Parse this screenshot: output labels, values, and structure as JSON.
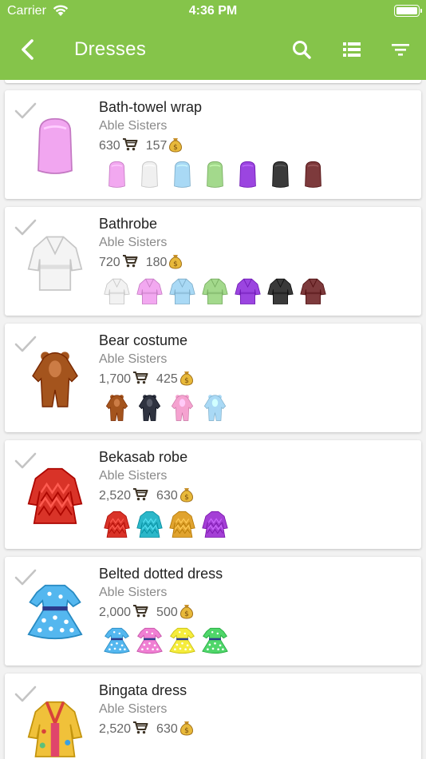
{
  "status_bar": {
    "carrier": "Carrier",
    "time": "4:36 PM"
  },
  "app_bar": {
    "title": "Dresses",
    "icons": [
      "back-arrow-icon",
      "search-icon",
      "list-view-icon",
      "filter-icon"
    ]
  },
  "colors": {
    "app_bar": "#85c44a",
    "background": "#f2f2f2",
    "card": "#ffffff"
  },
  "items": [
    {
      "name": "Bath-towel wrap",
      "maker": "Able Sisters",
      "buy_price": "630",
      "sell_price": "157",
      "shape": "towel",
      "main_color": "#f1a6f0",
      "variant_colors": [
        "#f2a8f0",
        "#f0f0f0",
        "#a9d9f5",
        "#a3d98c",
        "#9b45e0",
        "#3a3a3a",
        "#7d3a3c"
      ]
    },
    {
      "name": "Bathrobe",
      "maker": "Able Sisters",
      "buy_price": "720",
      "sell_price": "180",
      "shape": "robe",
      "main_color": "#f4f4f4",
      "variant_colors": [
        "#f2f2f2",
        "#f2a8f0",
        "#a9d9f5",
        "#a3d98c",
        "#9b45e0",
        "#3a3a3a",
        "#7d3a3c"
      ]
    },
    {
      "name": "Bear costume",
      "maker": "Able Sisters",
      "buy_price": "1,700",
      "sell_price": "425",
      "shape": "bear",
      "main_color": "#a4541d",
      "variant_colors": [
        "#a4541d",
        "#2f3340",
        "#f5a2d0",
        "#a9d9f5"
      ]
    },
    {
      "name": "Bekasab robe",
      "maker": "Able Sisters",
      "buy_price": "2,520",
      "sell_price": "630",
      "shape": "gown",
      "main_color": "#d93328",
      "variant_colors": [
        "#d93328",
        "#2bb7c9",
        "#e0a32e",
        "#a43fd6"
      ]
    },
    {
      "name": "Belted dotted dress",
      "maker": "Able Sisters",
      "buy_price": "2,000",
      "sell_price": "500",
      "shape": "dotted",
      "main_color": "#54b7ef",
      "variant_colors": [
        "#54b7ef",
        "#f07fd3",
        "#f5ec3c",
        "#4fd66a"
      ]
    },
    {
      "name": "Bingata dress",
      "maker": "Able Sisters",
      "buy_price": "2,520",
      "sell_price": "630",
      "shape": "bingata",
      "main_color": "#f0c13a",
      "variant_colors": []
    }
  ]
}
